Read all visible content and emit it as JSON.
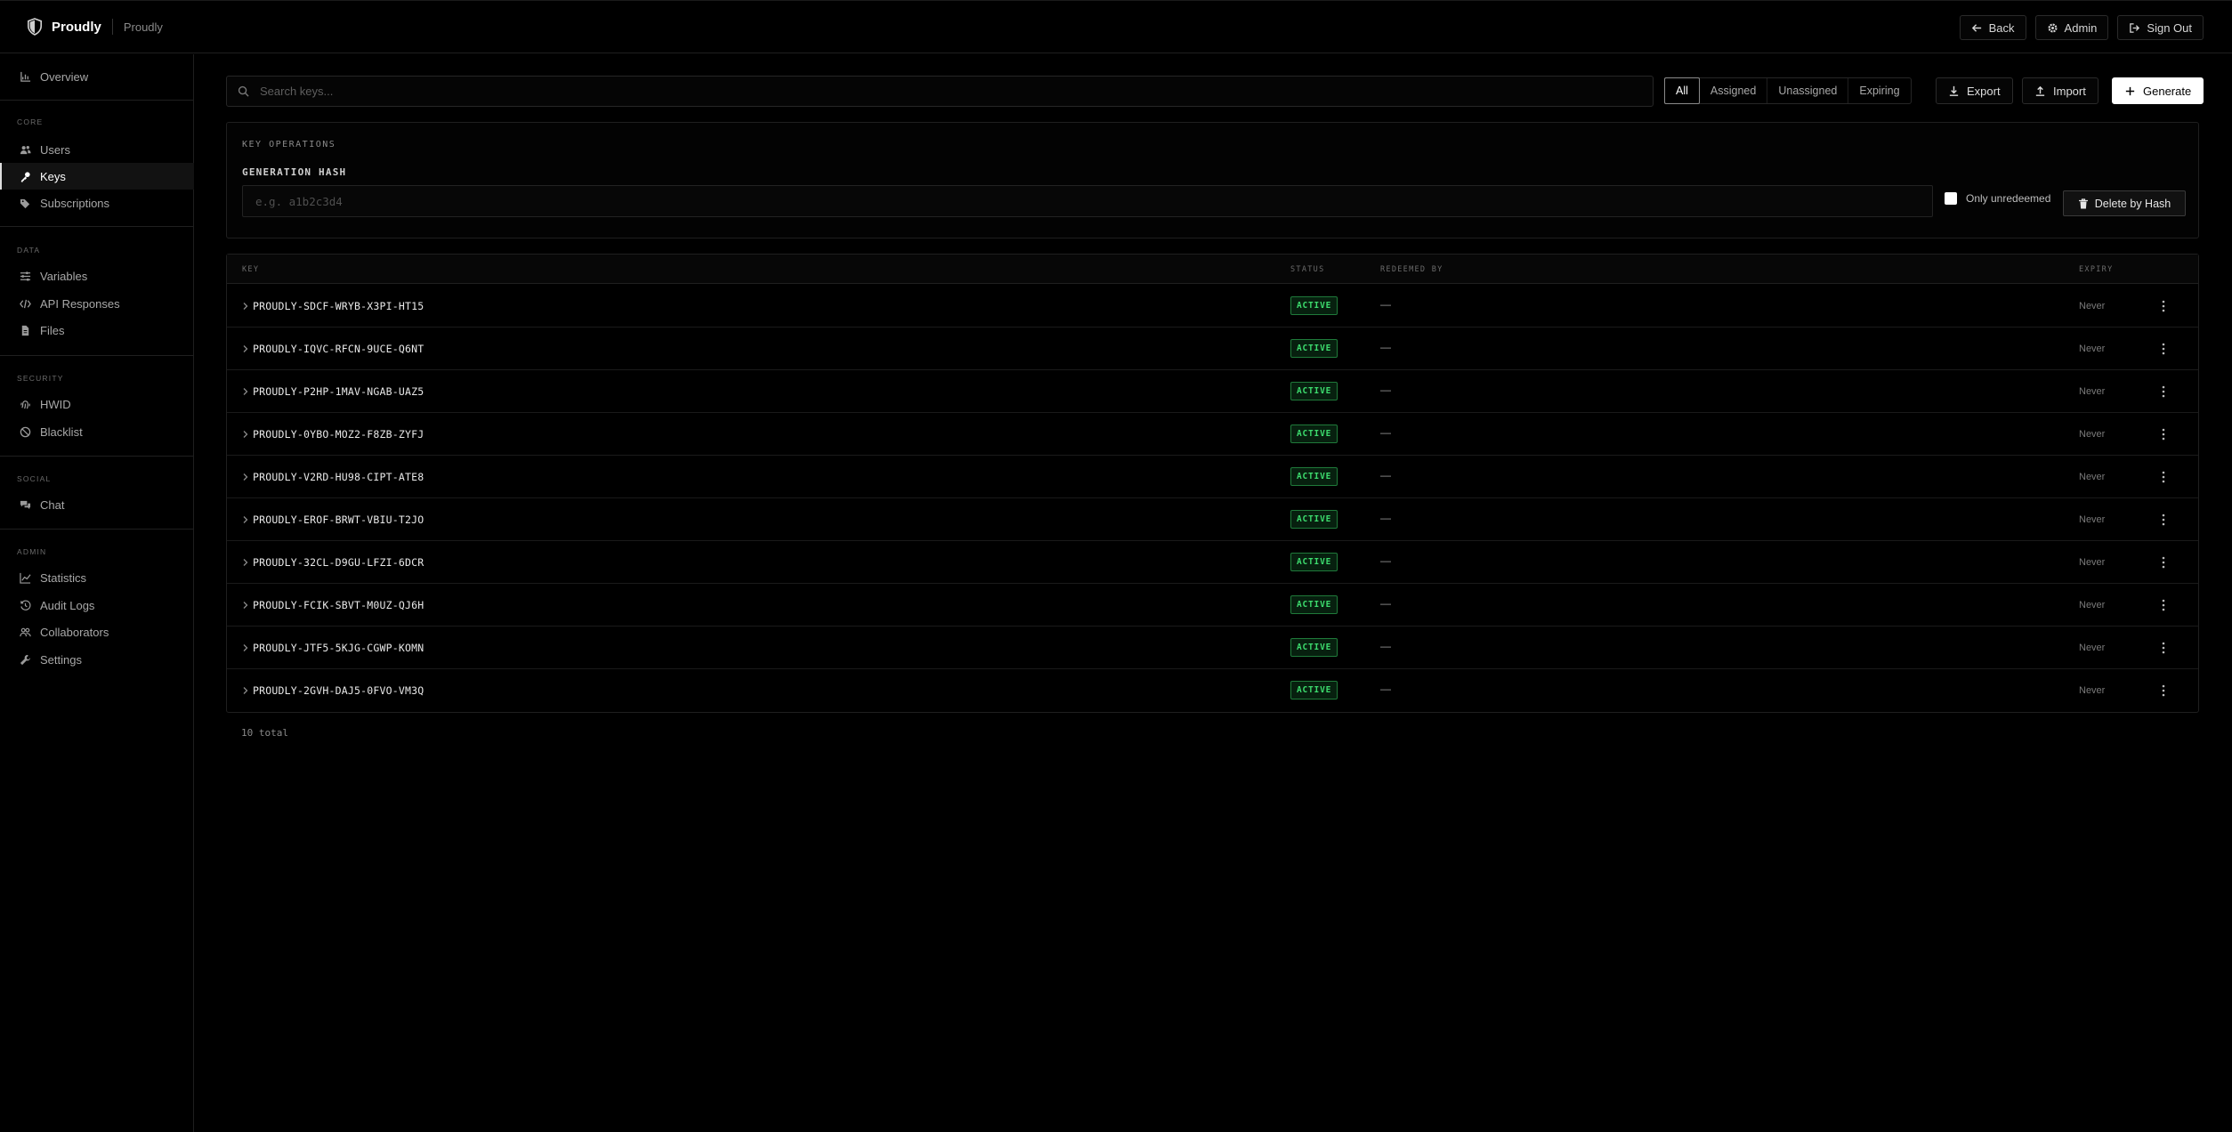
{
  "header": {
    "brand": "Proudly",
    "subtitle": "Proudly",
    "back": "Back",
    "admin": "Admin",
    "sign_out": "Sign Out"
  },
  "sidebar": {
    "overview": "Overview",
    "groups": {
      "core": "CORE",
      "data": "DATA",
      "security": "SECURITY",
      "social": "SOCIAL",
      "admin": "ADMIN"
    },
    "items": {
      "users": "Users",
      "keys": "Keys",
      "subscriptions": "Subscriptions",
      "variables": "Variables",
      "api_responses": "API Responses",
      "files": "Files",
      "hwid": "HWID",
      "blacklist": "Blacklist",
      "chat": "Chat",
      "statistics": "Statistics",
      "audit_logs": "Audit Logs",
      "collaborators": "Collaborators",
      "settings": "Settings"
    }
  },
  "toolbar": {
    "search_placeholder": "Search keys...",
    "filters": [
      "All",
      "Assigned",
      "Unassigned",
      "Expiring"
    ],
    "active_filter": "All",
    "export": "Export",
    "import": "Import",
    "generate": "Generate"
  },
  "ops": {
    "title": "KEY OPERATIONS",
    "hash_label": "GENERATION HASH",
    "hash_placeholder": "e.g. a1b2c3d4",
    "only_unredeemed": "Only unredeemed",
    "only_unredeemed_checked": false,
    "delete_by_hash": "Delete by Hash"
  },
  "table": {
    "columns": {
      "key": "KEY",
      "status": "STATUS",
      "redeemed_by": "REDEEMED BY",
      "expiry": "EXPIRY"
    },
    "rows": [
      {
        "key": "PROUDLY-SDCF-WRYB-X3PI-HT15",
        "status": "ACTIVE",
        "redeemed_by": "—",
        "expiry": "Never"
      },
      {
        "key": "PROUDLY-IQVC-RFCN-9UCE-Q6NT",
        "status": "ACTIVE",
        "redeemed_by": "—",
        "expiry": "Never"
      },
      {
        "key": "PROUDLY-P2HP-1MAV-NGAB-UAZ5",
        "status": "ACTIVE",
        "redeemed_by": "—",
        "expiry": "Never"
      },
      {
        "key": "PROUDLY-0YBO-MOZ2-F8ZB-ZYFJ",
        "status": "ACTIVE",
        "redeemed_by": "—",
        "expiry": "Never"
      },
      {
        "key": "PROUDLY-V2RD-HU98-CIPT-ATE8",
        "status": "ACTIVE",
        "redeemed_by": "—",
        "expiry": "Never"
      },
      {
        "key": "PROUDLY-EROF-BRWT-VBIU-T2JO",
        "status": "ACTIVE",
        "redeemed_by": "—",
        "expiry": "Never"
      },
      {
        "key": "PROUDLY-32CL-D9GU-LFZI-6DCR",
        "status": "ACTIVE",
        "redeemed_by": "—",
        "expiry": "Never"
      },
      {
        "key": "PROUDLY-FCIK-SBVT-M0UZ-QJ6H",
        "status": "ACTIVE",
        "redeemed_by": "—",
        "expiry": "Never"
      },
      {
        "key": "PROUDLY-JTF5-5KJG-CGWP-KOMN",
        "status": "ACTIVE",
        "redeemed_by": "—",
        "expiry": "Never"
      },
      {
        "key": "PROUDLY-2GVH-DAJ5-0FVO-VM3Q",
        "status": "ACTIVE",
        "redeemed_by": "—",
        "expiry": "Never"
      }
    ],
    "total": "10 total"
  },
  "colors": {
    "background": "#000000",
    "active_badge": "#3ddc6e",
    "primary_button": "#ffffff"
  }
}
